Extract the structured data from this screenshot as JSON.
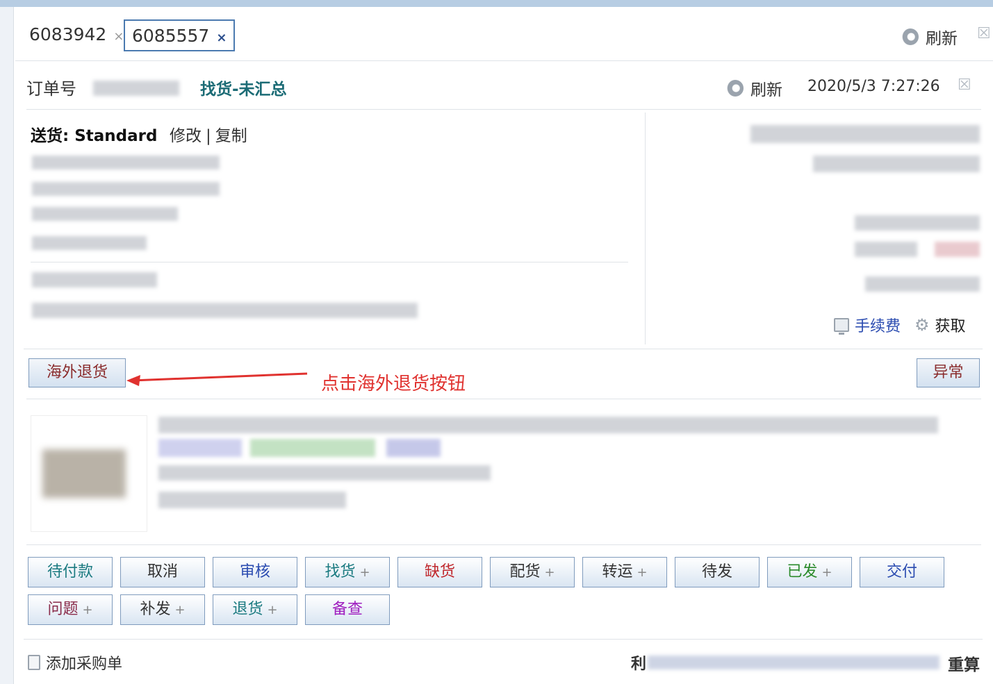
{
  "tabs": [
    {
      "label": "6083942",
      "close": "×"
    },
    {
      "label": "6085557",
      "close": "×"
    }
  ],
  "tabbar": {
    "refresh_label": "刷新",
    "close_icon": "close-icon"
  },
  "order": {
    "label": "订单号",
    "status": "找货-未汇总",
    "refresh_label": "刷新",
    "timestamp": "2020/5/3 7:27:26"
  },
  "shipping": {
    "title": "送货: Standard",
    "edit_label": "修改",
    "separator": "|",
    "copy_label": "复制"
  },
  "fee": {
    "link_label": "手续费",
    "fetch_label": "获取"
  },
  "actions": {
    "overseas_return_label": "海外退货",
    "abnormal_label": "异常",
    "annotation": "点击海外退货按钮"
  },
  "status_buttons": [
    {
      "label": "待付款",
      "plus": "",
      "color": "#1a7a80"
    },
    {
      "label": "取消",
      "plus": "",
      "color": "#333333"
    },
    {
      "label": "审核",
      "plus": "",
      "color": "#2a4bb0"
    },
    {
      "label": "找货",
      "plus": "+",
      "color": "#1a7a80"
    },
    {
      "label": "缺货",
      "plus": "",
      "color": "#c0282d"
    },
    {
      "label": "配货",
      "plus": "+",
      "color": "#333333"
    },
    {
      "label": "转运",
      "plus": "+",
      "color": "#333333"
    },
    {
      "label": "待发",
      "plus": "",
      "color": "#333333"
    },
    {
      "label": "已发",
      "plus": "+",
      "color": "#2a8a2a"
    },
    {
      "label": "交付",
      "plus": "",
      "color": "#2a4bb0"
    },
    {
      "label": "问题",
      "plus": "+",
      "color": "#8a2b4a"
    },
    {
      "label": "补发",
      "plus": "+",
      "color": "#333333"
    },
    {
      "label": "退货",
      "plus": "+",
      "color": "#1a7a80"
    },
    {
      "label": "备查",
      "plus": "",
      "color": "#a020c0"
    }
  ],
  "footer": {
    "add_po_label": "添加采购单",
    "profit_label": "利",
    "recalc_label": "重算"
  }
}
